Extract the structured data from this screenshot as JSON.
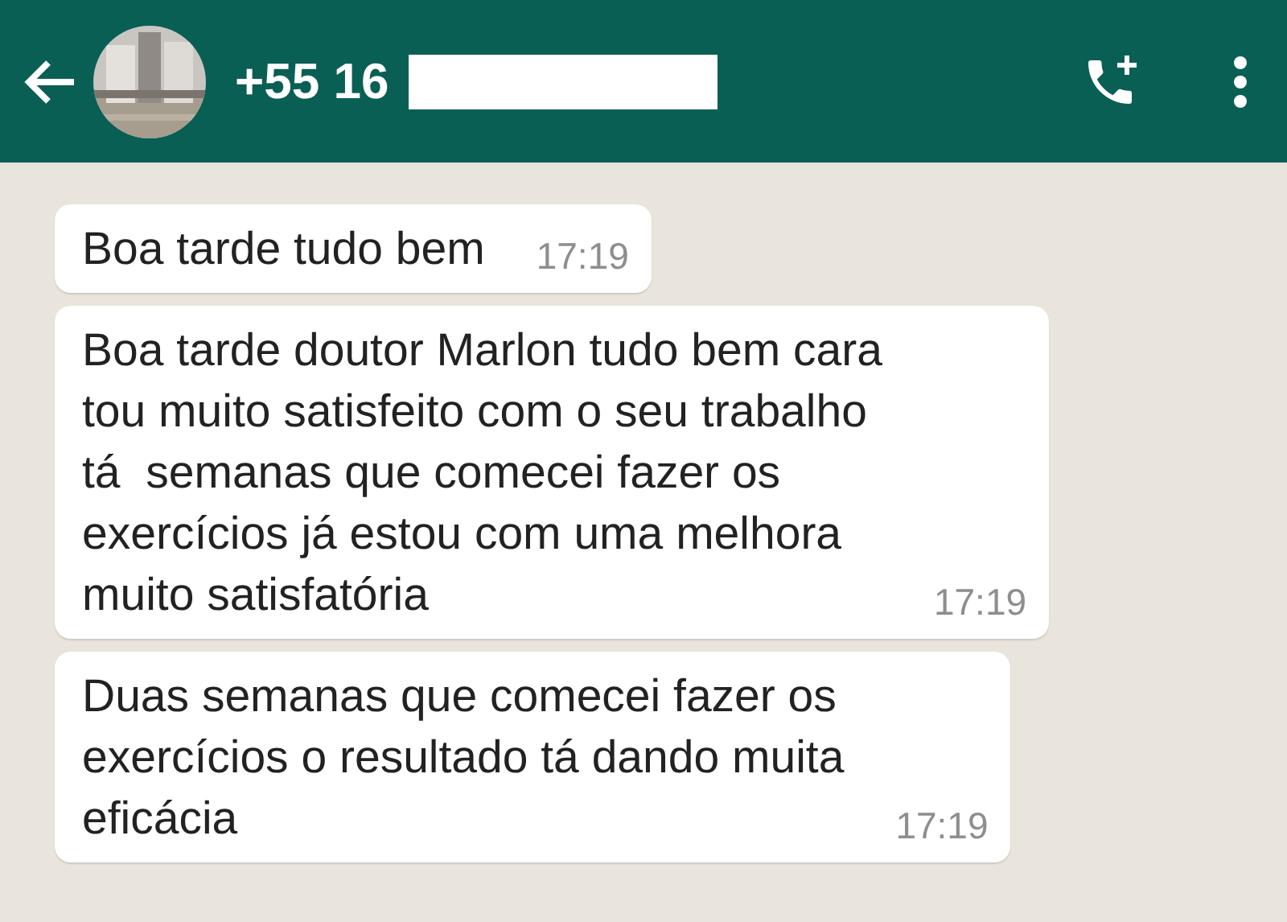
{
  "header": {
    "title": "+55 16",
    "redacted": true
  },
  "messages": [
    {
      "text": "Boa tarde tudo bem",
      "time": "17:19"
    },
    {
      "text": "Boa tarde doutor Marlon tudo bem cara\ntou muito satisfeito com o seu trabalho\ntá  semanas que comecei fazer os\nexercícios já estou com uma melhora\nmuito satisfatória",
      "time": "17:19"
    },
    {
      "text": "Duas semanas que comecei fazer os\nexercícios o resultado tá dando muita\neficácia",
      "time": "17:19"
    }
  ]
}
